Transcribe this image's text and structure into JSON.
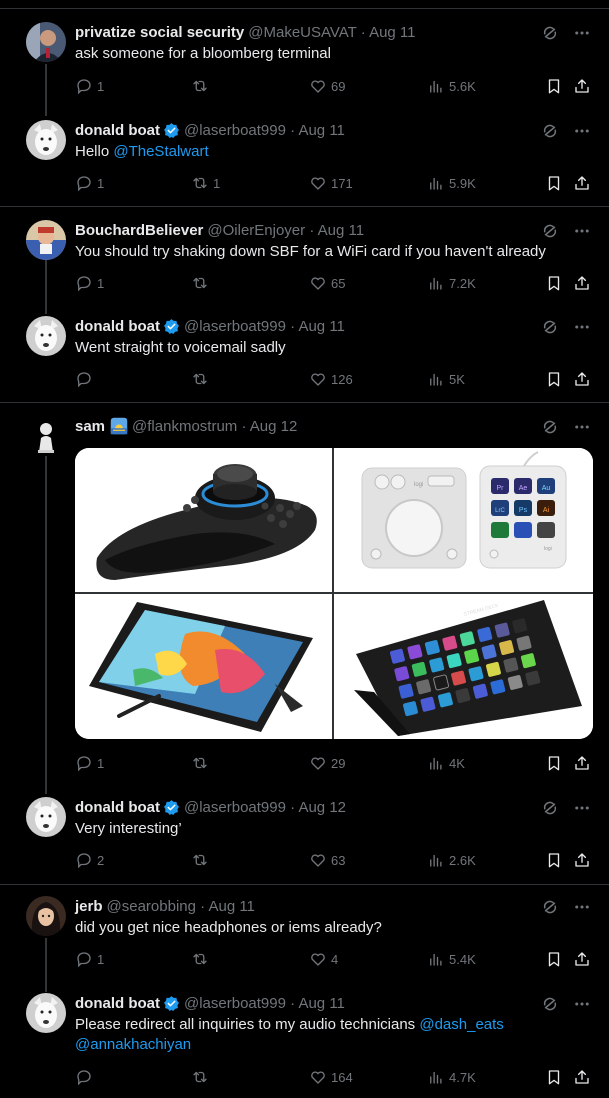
{
  "tweets": [
    {
      "name": "privatize social security",
      "handle": "@MakeUSAVAT · Aug 11",
      "text": "ask someone for a bloomberg terminal",
      "replies": "1",
      "retweets": "",
      "likes": "69",
      "views": "5.6K",
      "verified": false
    },
    {
      "name": "donald boat",
      "handle": "@laserboat999 · Aug 11",
      "text": "Hello ",
      "mentions": [
        "@TheStalwart"
      ],
      "replies": "1",
      "retweets": "1",
      "likes": "171",
      "views": "5.9K",
      "verified": true
    },
    {
      "name": "BouchardBeliever",
      "handle": "@OilerEnjoyer · Aug 11",
      "text": "You should try shaking down SBF for a WiFi card if you haven't already",
      "replies": "1",
      "retweets": "",
      "likes": "65",
      "views": "7.2K",
      "verified": false
    },
    {
      "name": "donald boat",
      "handle": "@laserboat999 · Aug 11",
      "text": "Went straight to voicemail sadly",
      "replies": "",
      "retweets": "",
      "likes": "126",
      "views": "5K",
      "verified": true
    },
    {
      "name": "sam",
      "handle": "@flankmostrum · Aug 12",
      "text": "",
      "replies": "1",
      "retweets": "",
      "likes": "29",
      "views": "4K",
      "verified": false,
      "emoji": "sunrise-emoji"
    },
    {
      "name": "donald boat",
      "handle": "@laserboat999 · Aug 12",
      "text": "Very interesting’",
      "replies": "2",
      "retweets": "",
      "likes": "63",
      "views": "2.6K",
      "verified": true
    },
    {
      "name": "jerb",
      "handle": "@searobbing · Aug 11",
      "text": "did you get nice headphones or iems already?",
      "replies": "1",
      "retweets": "",
      "likes": "4",
      "views": "5.4K",
      "verified": false
    },
    {
      "name": "donald boat",
      "handle": "@laserboat999 · Aug 11",
      "text": "Please redirect all inquiries to my audio technicians ",
      "mentions": [
        "@dash_eats",
        "@annakhachiyan"
      ],
      "replies": "",
      "retweets": "",
      "likes": "164",
      "views": "4.7K",
      "verified": true
    }
  ],
  "media": {
    "label_logi": "logi",
    "keys": [
      "Pr",
      "Ae",
      "Au",
      "LrC",
      "Ps",
      "Ai"
    ],
    "stream_deck_label": "STREAM DECK"
  },
  "colors": {
    "background": "#000000",
    "text": "#e7e9ea",
    "muted": "#71767b",
    "accent": "#1d9bf0",
    "border": "#2f3336"
  },
  "icons": [
    "reply-icon",
    "retweet-icon",
    "like-icon",
    "views-icon",
    "bookmark-icon",
    "share-icon",
    "grok-icon",
    "more-icon",
    "verified-icon"
  ]
}
